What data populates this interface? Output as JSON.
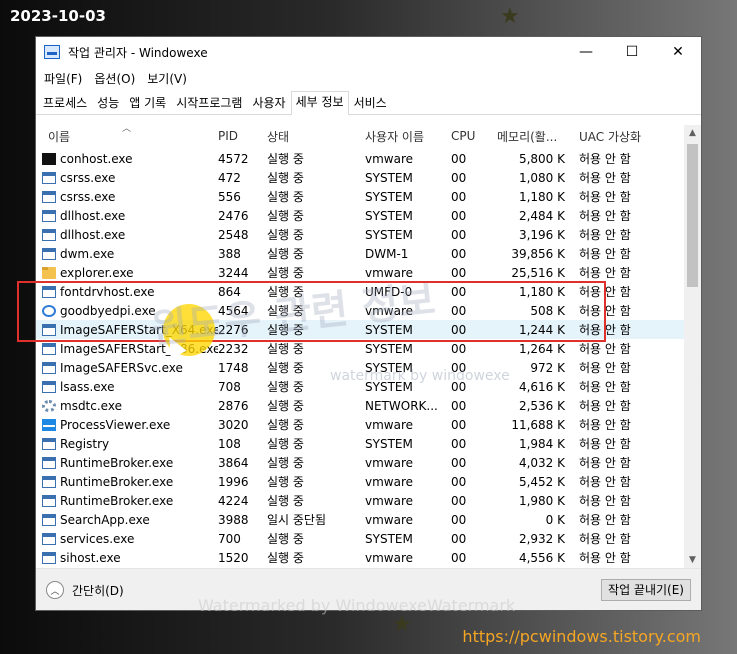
{
  "date_stamp": "2023-10-03",
  "site_url": "https://pcwindows.tistory.com",
  "window": {
    "title": "작업 관리자   - Windowexe",
    "minimize": "—",
    "maximize": "☐",
    "close": "✕"
  },
  "menu": [
    "파일(F)",
    "옵션(O)",
    "보기(V)"
  ],
  "tabs": [
    {
      "label": "프로세스",
      "active": false
    },
    {
      "label": "성능",
      "active": false
    },
    {
      "label": "앱 기록",
      "active": false
    },
    {
      "label": "시작프로그램",
      "active": false
    },
    {
      "label": "사용자",
      "active": false
    },
    {
      "label": "세부 정보",
      "active": true
    },
    {
      "label": "서비스",
      "active": false
    }
  ],
  "columns": {
    "name": "이름",
    "pid": "PID",
    "status": "상태",
    "user": "사용자 이름",
    "cpu": "CPU",
    "memory": "메모리(활...",
    "uac": "UAC 가상화"
  },
  "rows": [
    {
      "name": "conhost.exe",
      "pid": "4572",
      "status": "실행 중",
      "user": "vmware",
      "cpu": "00",
      "mem": "5,800 K",
      "uac": "허용 안 함",
      "icon": "console-icon"
    },
    {
      "name": "csrss.exe",
      "pid": "472",
      "status": "실행 중",
      "user": "SYSTEM",
      "cpu": "00",
      "mem": "1,080 K",
      "uac": "허용 안 함",
      "icon": "window-icon"
    },
    {
      "name": "csrss.exe",
      "pid": "556",
      "status": "실행 중",
      "user": "SYSTEM",
      "cpu": "00",
      "mem": "1,180 K",
      "uac": "허용 안 함",
      "icon": "window-icon"
    },
    {
      "name": "dllhost.exe",
      "pid": "2476",
      "status": "실행 중",
      "user": "SYSTEM",
      "cpu": "00",
      "mem": "2,484 K",
      "uac": "허용 안 함",
      "icon": "window-icon"
    },
    {
      "name": "dllhost.exe",
      "pid": "2548",
      "status": "실행 중",
      "user": "SYSTEM",
      "cpu": "00",
      "mem": "3,196 K",
      "uac": "허용 안 함",
      "icon": "window-icon"
    },
    {
      "name": "dwm.exe",
      "pid": "388",
      "status": "실행 중",
      "user": "DWM-1",
      "cpu": "00",
      "mem": "39,856 K",
      "uac": "허용 안 함",
      "icon": "window-icon"
    },
    {
      "name": "explorer.exe",
      "pid": "3244",
      "status": "실행 중",
      "user": "vmware",
      "cpu": "00",
      "mem": "25,516 K",
      "uac": "허용 안 함",
      "icon": "folder-icon"
    },
    {
      "name": "fontdrvhost.exe",
      "pid": "864",
      "status": "실행 중",
      "user": "UMFD-0",
      "cpu": "00",
      "mem": "1,180 K",
      "uac": "허용 안 함",
      "icon": "window-icon"
    },
    {
      "name": "goodbyedpi.exe",
      "pid": "4564",
      "status": "실행 중",
      "user": "vmware",
      "cpu": "00",
      "mem": "508 K",
      "uac": "허용 안 함",
      "icon": "spinner-icon"
    },
    {
      "name": "ImageSAFERStart_X64.exe",
      "pid": "2276",
      "status": "실행 중",
      "user": "SYSTEM",
      "cpu": "00",
      "mem": "1,244 K",
      "uac": "허용 안 함",
      "icon": "window-icon",
      "selected": true
    },
    {
      "name": "ImageSAFERStart_X86.exe",
      "pid": "2232",
      "status": "실행 중",
      "user": "SYSTEM",
      "cpu": "00",
      "mem": "1,264 K",
      "uac": "허용 안 함",
      "icon": "window-icon"
    },
    {
      "name": "ImageSAFERSvc.exe",
      "pid": "1748",
      "status": "실행 중",
      "user": "SYSTEM",
      "cpu": "00",
      "mem": "972 K",
      "uac": "허용 안 함",
      "icon": "window-icon"
    },
    {
      "name": "lsass.exe",
      "pid": "708",
      "status": "실행 중",
      "user": "SYSTEM",
      "cpu": "00",
      "mem": "4,616 K",
      "uac": "허용 안 함",
      "icon": "window-icon"
    },
    {
      "name": "msdtc.exe",
      "pid": "2876",
      "status": "실행 중",
      "user": "NETWORK...",
      "cpu": "00",
      "mem": "2,536 K",
      "uac": "허용 안 함",
      "icon": "gear-icon"
    },
    {
      "name": "ProcessViewer.exe",
      "pid": "3020",
      "status": "실행 중",
      "user": "vmware",
      "cpu": "00",
      "mem": "11,688 K",
      "uac": "허용 안 함",
      "icon": "pulse-icon"
    },
    {
      "name": "Registry",
      "pid": "108",
      "status": "실행 중",
      "user": "SYSTEM",
      "cpu": "00",
      "mem": "1,984 K",
      "uac": "허용 안 함",
      "icon": "window-icon"
    },
    {
      "name": "RuntimeBroker.exe",
      "pid": "3864",
      "status": "실행 중",
      "user": "vmware",
      "cpu": "00",
      "mem": "4,032 K",
      "uac": "허용 안 함",
      "icon": "window-icon"
    },
    {
      "name": "RuntimeBroker.exe",
      "pid": "1996",
      "status": "실행 중",
      "user": "vmware",
      "cpu": "00",
      "mem": "5,452 K",
      "uac": "허용 안 함",
      "icon": "window-icon"
    },
    {
      "name": "RuntimeBroker.exe",
      "pid": "4224",
      "status": "실행 중",
      "user": "vmware",
      "cpu": "00",
      "mem": "1,980 K",
      "uac": "허용 안 함",
      "icon": "window-icon"
    },
    {
      "name": "SearchApp.exe",
      "pid": "3988",
      "status": "일시 중단됨",
      "user": "vmware",
      "cpu": "00",
      "mem": "0 K",
      "uac": "허용 안 함",
      "icon": "window-icon"
    },
    {
      "name": "services.exe",
      "pid": "700",
      "status": "실행 중",
      "user": "SYSTEM",
      "cpu": "00",
      "mem": "2,932 K",
      "uac": "허용 안 함",
      "icon": "window-icon"
    },
    {
      "name": "sihost.exe",
      "pid": "1520",
      "status": "실행 중",
      "user": "vmware",
      "cpu": "00",
      "mem": "4,556 K",
      "uac": "허용 안 함",
      "icon": "window-icon"
    }
  ],
  "footer": {
    "less_label": "간단히(D)",
    "end_task_label": "작업 끝내기(E)"
  },
  "watermarks": {
    "big": "윈도우 관련 정보",
    "small": "watermark by windowexe",
    "footer": "Watermarked by WindowexeWatermark"
  }
}
